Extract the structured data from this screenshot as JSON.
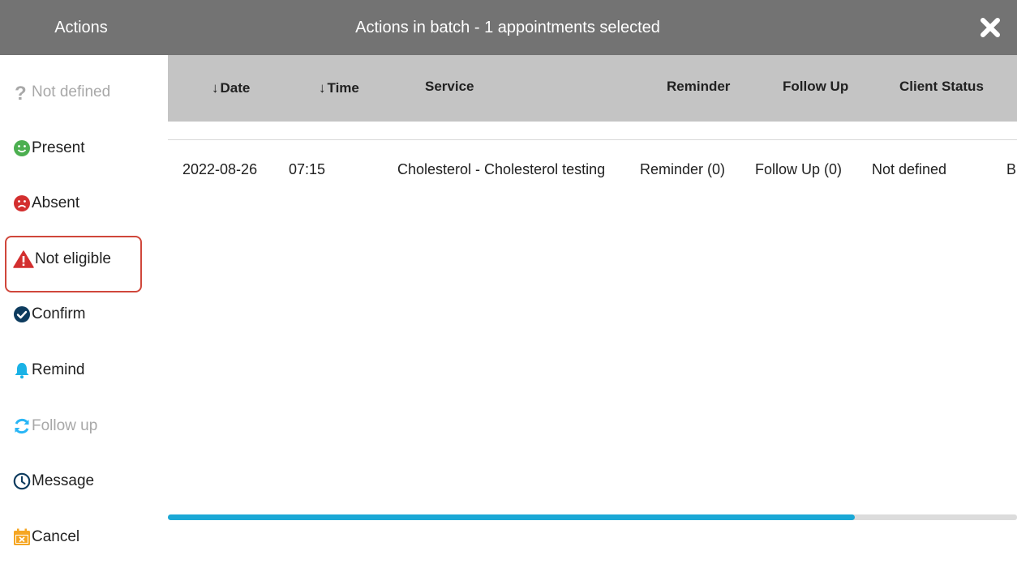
{
  "header": {
    "left_title": "Actions",
    "center_title": "Actions in batch - 1 appointments selected",
    "close_icon": "close-icon"
  },
  "sidebar": {
    "items": [
      {
        "label": "Not defined",
        "icon": "question-icon",
        "color": "#a8a8a8",
        "disabled": true
      },
      {
        "label": "Present",
        "icon": "smile-icon",
        "color": "#4caf50"
      },
      {
        "label": "Absent",
        "icon": "frown-icon",
        "color": "#d32f2f"
      },
      {
        "label": "Not eligible",
        "icon": "warning-icon",
        "color": "#d32f2f",
        "highlighted": true
      },
      {
        "label": "Confirm",
        "icon": "check-circle-icon",
        "color": "#0d3b5e"
      },
      {
        "label": "Remind",
        "icon": "bell-icon",
        "color": "#1ab2e6"
      },
      {
        "label": "Follow up",
        "icon": "refresh-icon",
        "color": "#29b6f6",
        "disabled": true
      },
      {
        "label": "Message",
        "icon": "clock-icon",
        "color": "#0d3b5e"
      },
      {
        "label": "Cancel",
        "icon": "calendar-cancel-icon",
        "color": "#f5a623"
      }
    ]
  },
  "table": {
    "columns": [
      {
        "label": "Date",
        "sort_arrow": "↓"
      },
      {
        "label": "Time",
        "sort_arrow": "↓"
      },
      {
        "label": "Service"
      },
      {
        "label": "Reminder"
      },
      {
        "label": "Follow Up"
      },
      {
        "label": "Client Status"
      }
    ],
    "rows": [
      {
        "date": "2022-08-26",
        "time": "07:15",
        "service": "Cholesterol - Cholesterol testing",
        "reminder": "Reminder (0)",
        "follow_up": "Follow Up (0)",
        "client_status": "Not defined",
        "overflow": "B"
      }
    ]
  },
  "scrollbar": {
    "thumb_color": "#1aa8d6",
    "position_fraction": 0.81
  }
}
